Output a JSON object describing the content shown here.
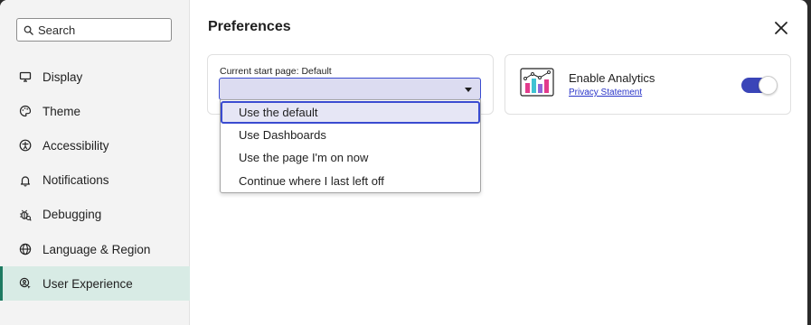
{
  "colors": {
    "accent": "#3a45b8",
    "active_nav_bg": "#d8ebe5",
    "active_nav_bar": "#1d7a61",
    "link": "#2a35c9",
    "sidebar_bg": "#f3f3f3"
  },
  "search": {
    "label": "Search",
    "icon": "search-icon"
  },
  "sidebar": {
    "items": [
      {
        "label": "Display",
        "icon": "monitor-icon"
      },
      {
        "label": "Theme",
        "icon": "palette-icon"
      },
      {
        "label": "Accessibility",
        "icon": "accessibility-icon"
      },
      {
        "label": "Notifications",
        "icon": "bell-icon"
      },
      {
        "label": "Debugging",
        "icon": "bug-icon"
      },
      {
        "label": "Language & Region",
        "icon": "globe-icon"
      },
      {
        "label": "User Experience",
        "icon": "user-experience-icon",
        "active": true
      }
    ]
  },
  "main": {
    "title": "Preferences",
    "close_icon": "close-icon",
    "start_page": {
      "label": "Current start page: Default",
      "selected_value": "",
      "options": [
        {
          "label": "Use the default",
          "highlighted": true
        },
        {
          "label": "Use Dashboards"
        },
        {
          "label": "Use the page I'm on now"
        },
        {
          "label": "Continue where I last left off"
        }
      ]
    },
    "analytics": {
      "icon": "analytics-chart-icon",
      "title": "Enable Analytics",
      "link": "Privacy Statement",
      "enabled": true
    }
  }
}
